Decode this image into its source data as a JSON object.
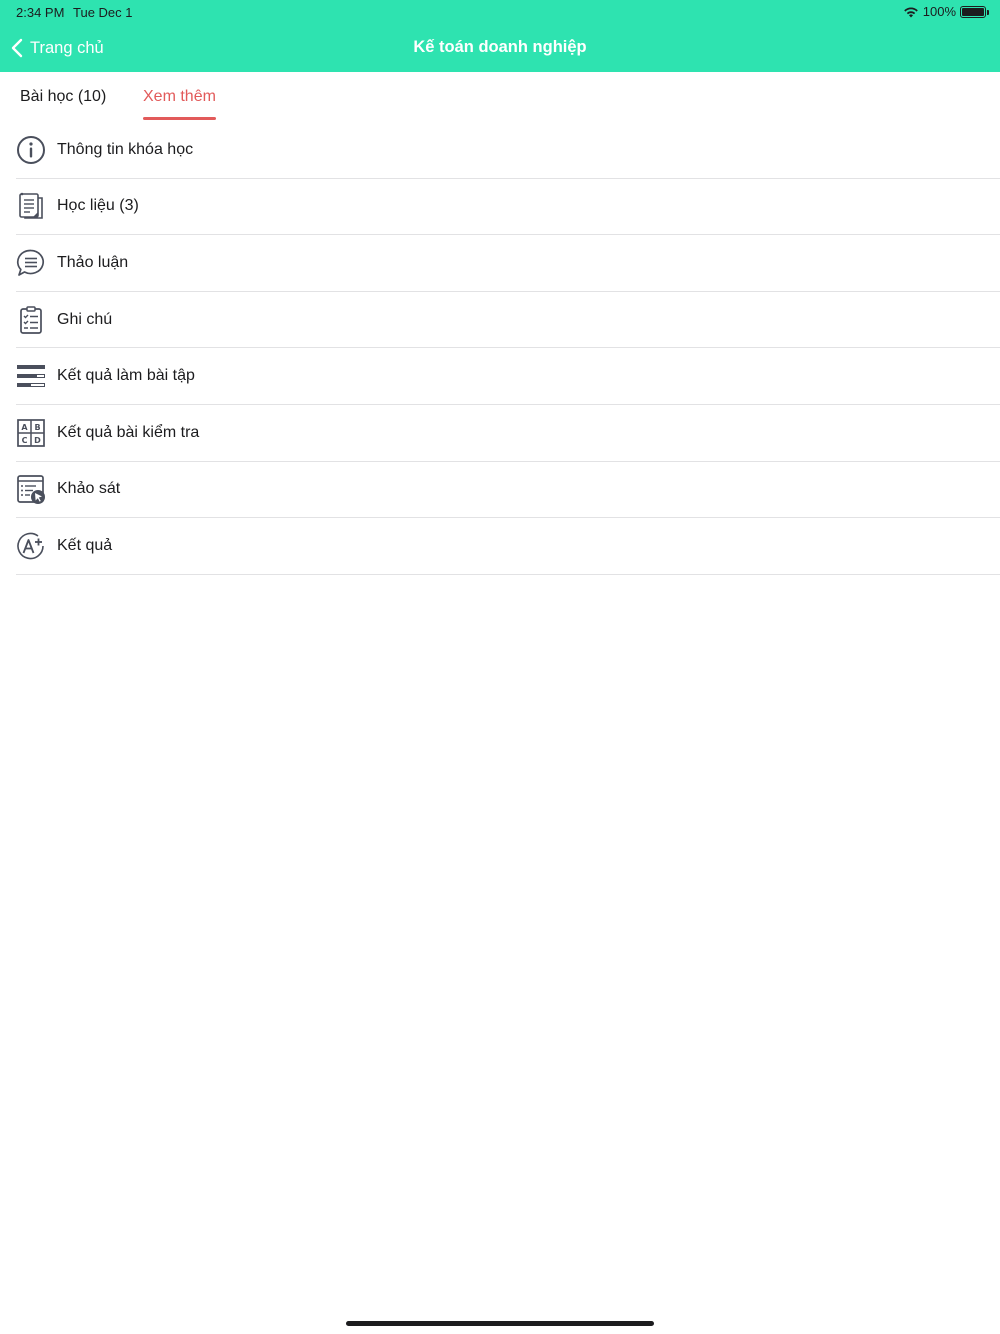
{
  "status_bar": {
    "time": "2:34 PM",
    "date": "Tue Dec 1",
    "battery": "100%"
  },
  "header": {
    "back_label": "Trang chủ",
    "title": "Kế toán doanh nghiệp",
    "background_color": "#2ee3b0"
  },
  "tabs": {
    "lessons_label": "Bài học (10)",
    "more_label": "Xem thêm",
    "active_tab": "more",
    "active_color": "#e25a5a"
  },
  "menu": {
    "items": [
      {
        "label": "Thông tin khóa học",
        "icon": "info-icon"
      },
      {
        "label": "Học liệu (3)",
        "icon": "documents-icon"
      },
      {
        "label": "Thảo luận",
        "icon": "chat-bubble-icon"
      },
      {
        "label": "Ghi chú",
        "icon": "clipboard-checklist-icon"
      },
      {
        "label": "Kết quả làm bài tập",
        "icon": "list-bars-icon"
      },
      {
        "label": "Kết quả bài kiểm tra",
        "icon": "abcd-grid-icon"
      },
      {
        "label": "Khảo sát",
        "icon": "survey-cursor-icon"
      },
      {
        "label": "Kết quả",
        "icon": "grade-a-plus-icon"
      }
    ]
  }
}
